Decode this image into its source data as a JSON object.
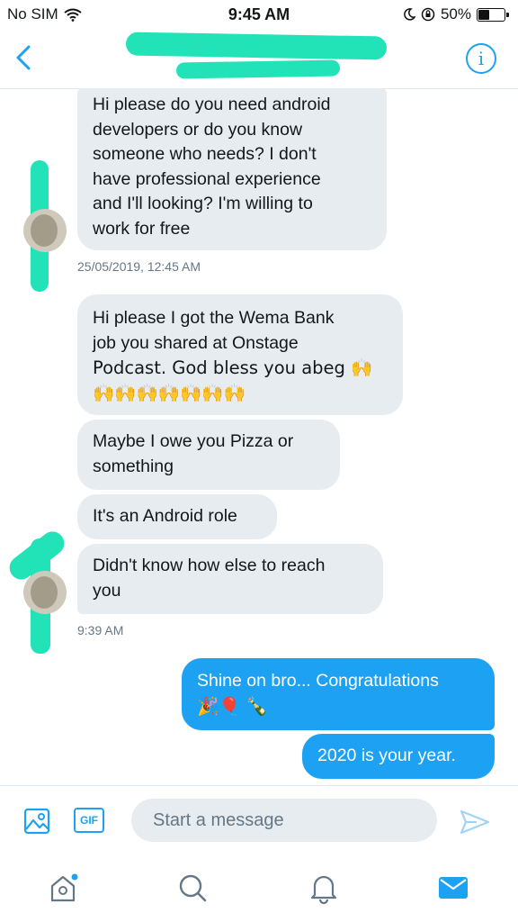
{
  "status_bar": {
    "carrier": "No SIM",
    "time": "9:45 AM",
    "battery": "50%",
    "battery_level": 0.5
  },
  "header": {
    "back_icon": "chevron-left-icon",
    "info_icon": "info-icon"
  },
  "messages": {
    "received_1": [
      "Hi please do you need android",
      "developers or do you  know",
      "someone who needs? I don't",
      "have professional experience",
      "and I'll looking? I'm willing to",
      "work for free"
    ],
    "timestamp_1": "25/05/2019, 12:45 AM",
    "received_2": [
      "Hi please I got the Wema Bank",
      "job you shared at Onstage",
      "Podcast. God bless you abeg 🙌",
      "🙌🙌🙌🙌🙌🙌🙌"
    ],
    "received_3": [
      "Maybe I owe you Pizza or",
      "something"
    ],
    "received_4": [
      "It's an Android role"
    ],
    "received_5": [
      "Didn't know how else to reach",
      "you"
    ],
    "timestamp_2": "9:39 AM",
    "sent_1": [
      "Shine on bro... Congratulations",
      "🎉🎈 🍾"
    ],
    "sent_2": [
      "2020 is your year."
    ]
  },
  "compose": {
    "gif_label": "GIF",
    "placeholder": "Start a message"
  },
  "colors": {
    "accent": "#1da1f2",
    "bubble_received": "#e6ecf0",
    "scribble": "#22e3b8"
  }
}
